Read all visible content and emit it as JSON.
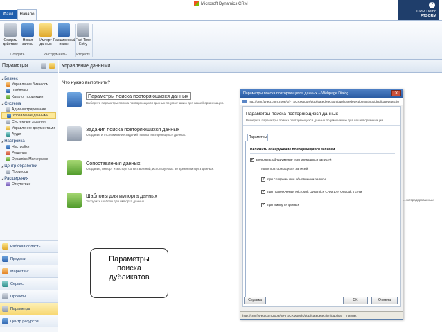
{
  "app": {
    "brand": "Microsoft Dynamics CRM",
    "file_tab": "Файл",
    "home_tab": "Начало",
    "user": "CRM Demo",
    "org": "FTSCRM",
    "help": "?"
  },
  "ribbon": {
    "buttons": [
      {
        "label": "Создать действие",
        "icon": "create-activity-icon"
      },
      {
        "label": "Новая запись",
        "icon": "new-record-icon"
      },
      {
        "label": "Импорт данных",
        "icon": "import-icon"
      },
      {
        "label": "Расширенный поиск",
        "icon": "advanced-find-icon"
      },
      {
        "label": "Fast Time Entry",
        "icon": "time-entry-icon"
      }
    ],
    "groups": [
      "Создать",
      "Инструменты",
      "Projects"
    ]
  },
  "nav": {
    "header": "Параметры",
    "sections": [
      {
        "title": "Бизнес",
        "items": [
          {
            "label": "Управление бизнесом",
            "selected": false
          },
          {
            "label": "Шаблоны",
            "selected": false
          },
          {
            "label": "Каталог продукции",
            "selected": false
          }
        ]
      },
      {
        "title": "Система",
        "items": [
          {
            "label": "Администрирование",
            "selected": false
          },
          {
            "label": "Управление данными",
            "selected": true
          },
          {
            "label": "Системные задания",
            "selected": false
          },
          {
            "label": "Управление документами",
            "selected": false
          },
          {
            "label": "Аудит",
            "selected": false
          }
        ]
      },
      {
        "title": "Настройка",
        "items": [
          {
            "label": "Настройки",
            "selected": false
          },
          {
            "label": "Решения",
            "selected": false
          },
          {
            "label": "Dynamics Marketplace",
            "selected": false
          }
        ]
      },
      {
        "title": "Центр обработки",
        "items": [
          {
            "label": "Процессы",
            "selected": false
          }
        ]
      },
      {
        "title": "Расширения",
        "items": [
          {
            "label": "Отсутствие",
            "selected": false
          }
        ]
      }
    ],
    "workplace": [
      {
        "label": "Рабочая область",
        "selected": false
      },
      {
        "label": "Продажи",
        "selected": false
      },
      {
        "label": "Маркетинг",
        "selected": false
      },
      {
        "label": "Сервис",
        "selected": false
      },
      {
        "label": "Проекты",
        "selected": false
      },
      {
        "label": "Параметры",
        "selected": true
      },
      {
        "label": "Центр ресурсов",
        "selected": false
      }
    ]
  },
  "main": {
    "header": "Управление данными",
    "question": "Что нужно выполнить?",
    "options": [
      {
        "title": "Параметры поиска повторяющихся данных",
        "desc": "Выберите параметры поиска повторяющихся данных по умолчанию для вашей организации."
      },
      {
        "title": "Задания поиска повторяющихся данных",
        "desc": "Создание и отслеживание заданий поиска повторяющихся данных."
      },
      {
        "title": "Сопоставления данных",
        "desc": "Создание, импорт и экспорт сопоставлений, используемых во время импорта данных."
      },
      {
        "title": "Шаблоны для импорта данных",
        "desc": "Загрузить шаблон для импорта данных."
      }
    ],
    "truncated_text": "...экстрадированных"
  },
  "callout": {
    "text_lines": [
      "Параметры",
      "поиска",
      "дубликатов"
    ]
  },
  "dialog": {
    "title": "Параметры поиска повторяющихся данных -- Webpage Dialog",
    "url": "http://crm.fts-eu.com:2008/0/FTSCRM/tools/duplicatedetection/duplicatedetectionsettings/duplicatedetectio",
    "heading": "Параметры поиска повторяющихся данных",
    "subheading": "Выберите параметры поиска повторяющихся данных по умолчанию для вашей организации.",
    "tab": "Параметры",
    "section_title": "Включить обнаружение повторяющихся записей",
    "enable_label": "Включить обнаружение повторяющихся записей",
    "enable_checked": true,
    "subtitle": "Поиск повторяющихся записей:",
    "options": [
      {
        "label": "при создании или обновлении записи",
        "checked": true
      },
      {
        "label": "при подключении Microsoft Dynamics CRM для Outlook к сети",
        "checked": true
      },
      {
        "label": "при импорте данных",
        "checked": true
      }
    ],
    "help_button": "Справка",
    "ok_button": "OK",
    "cancel_button": "Отмена",
    "status_url": "http://crm.fts-eu.com:2008/0/FTSCRM/tools/duplicatedetection/duplica",
    "status_zone": "Internet"
  }
}
